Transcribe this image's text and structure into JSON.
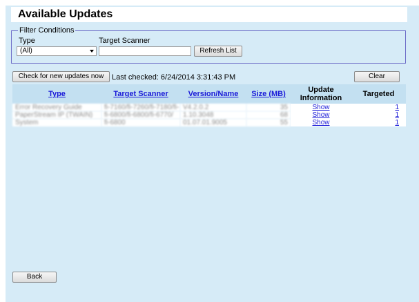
{
  "page": {
    "title": "Available Updates"
  },
  "filter": {
    "legend": "Filter Conditions",
    "type_label": "Type",
    "type_value": "(All)",
    "scanner_label": "Target Scanner",
    "scanner_value": "",
    "refresh_label": "Refresh List"
  },
  "toolbar": {
    "check_label": "Check for new updates now",
    "last_checked": "Last checked: 6/24/2014 3:31:43 PM",
    "clear_label": "Clear"
  },
  "table": {
    "headers": {
      "type": "Type",
      "scanner": "Target Scanner",
      "version": "Version/Name",
      "size": "Size (MB)",
      "update_info_line1": "Update",
      "update_info_line2": "Information",
      "targeted": "Targeted"
    },
    "rows": [
      {
        "type": "Error Recovery Guide",
        "scanner": "fi-7160/fi-7260/fi-7180/fi-",
        "version": "V4.2.0.2",
        "size": "35",
        "info": "Show",
        "targeted": "1"
      },
      {
        "type": "PaperStream IP (TWAIN)",
        "scanner": "fi-6800/fi-6800/fi-6770/",
        "version": "1.10.3048",
        "size": "68",
        "info": "Show",
        "targeted": "1"
      },
      {
        "type": "System",
        "scanner": "fi-6800",
        "version": "01.07.01.9005",
        "size": "55",
        "info": "Show",
        "targeted": "1"
      }
    ]
  },
  "footer": {
    "back_label": "Back"
  }
}
